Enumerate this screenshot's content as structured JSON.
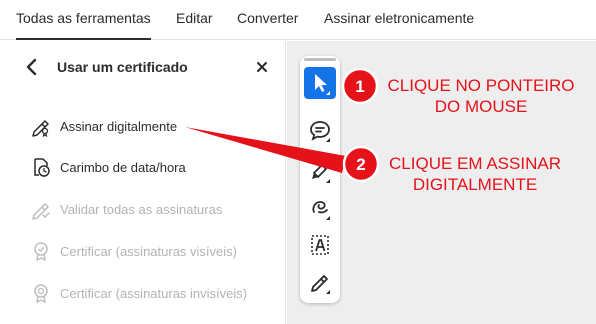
{
  "top_nav": {
    "tabs": [
      {
        "label": "Todas as ferramentas",
        "active": true
      },
      {
        "label": "Editar",
        "active": false
      },
      {
        "label": "Converter",
        "active": false
      },
      {
        "label": "Assinar eletronicamente",
        "active": false
      }
    ]
  },
  "panel": {
    "back_icon": "chevron-left-icon",
    "title": "Usar um certificado",
    "close_icon": "close-icon",
    "items": [
      {
        "label": "Assinar digitalmente",
        "icon": "sign-pen-icon",
        "enabled": true
      },
      {
        "label": "Carimbo de data/hora",
        "icon": "document-clock-icon",
        "enabled": true
      },
      {
        "label": "Validar todas as assinaturas",
        "icon": "validate-pen-icon",
        "enabled": false
      },
      {
        "label": "Certificar (assinaturas visíveis)",
        "icon": "certificate-badge-icon",
        "enabled": false
      },
      {
        "label": "Certificar (assinaturas invisíveis)",
        "icon": "certificate-ribbon-icon",
        "enabled": false
      }
    ]
  },
  "toolbar": {
    "tools": [
      {
        "name": "pointer-tool",
        "icon": "cursor-arrow-icon",
        "selected": true
      },
      {
        "name": "comment-tool",
        "icon": "comment-edit-icon",
        "selected": false
      },
      {
        "name": "highlight-tool",
        "icon": "highlighter-icon",
        "selected": false
      },
      {
        "name": "draw-tool",
        "icon": "freehand-draw-icon",
        "selected": false
      },
      {
        "name": "text-tool",
        "icon": "text-box-icon",
        "selected": false
      },
      {
        "name": "sign-tool",
        "icon": "sign-pen-icon",
        "selected": false
      }
    ]
  },
  "annotations": {
    "step1": {
      "number": "1",
      "text_line1": "CLIQUE NO PONTEIRO",
      "text_line2": "DO MOUSE"
    },
    "step2": {
      "number": "2",
      "text_line1": "CLIQUE EM ASSINAR",
      "text_line2": "DIGITALMENTE"
    },
    "color": "#e5121a"
  },
  "colors": {
    "accent": "#1473e6",
    "canvas_bg": "#eeeeee",
    "disabled_text": "#b3b3b3"
  }
}
